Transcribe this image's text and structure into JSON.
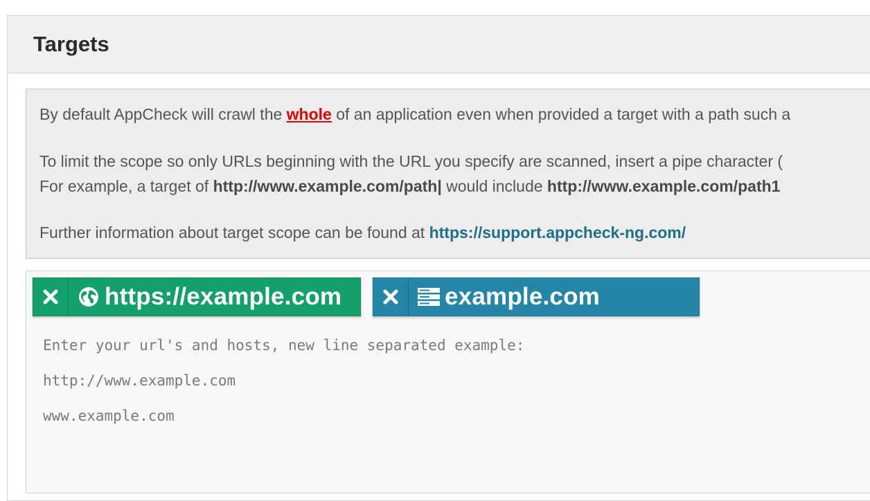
{
  "panel": {
    "title": "Targets"
  },
  "info": {
    "line1_prefix": "By default AppCheck will crawl the ",
    "line1_emphasis": "whole",
    "line1_suffix": " of an application even when provided a target with a path such a",
    "line2": "To limit the scope so only URLs beginning with the URL you specify are scanned, insert a pipe character (",
    "line3_prefix": "For example, a target of ",
    "line3_example1": "http://www.example.com/path|",
    "line3_middle": " would include ",
    "line3_example2": "http://www.example.com/path1",
    "line4_prefix": "Further information about target scope can be found at ",
    "line4_link": "https://support.appcheck-ng.com/"
  },
  "targets": [
    {
      "label": "https://example.com",
      "type": "url",
      "icon": "globe-icon",
      "color": "#14a06a"
    },
    {
      "label": "example.com",
      "type": "host",
      "icon": "server-icon",
      "color": "#2587a8"
    }
  ],
  "input": {
    "placeholder_line1": "Enter your url's and hosts, new line separated example:",
    "placeholder_line2": "http://www.example.com",
    "placeholder_line3": "www.example.com"
  }
}
